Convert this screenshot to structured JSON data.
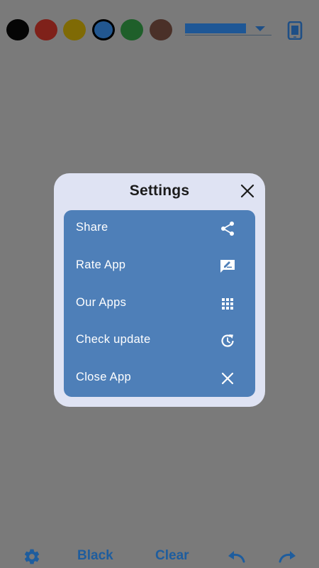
{
  "toolbar": {
    "swatches": [
      {
        "name": "black",
        "color": "#050505"
      },
      {
        "name": "red",
        "color": "#7f211a"
      },
      {
        "name": "yellow",
        "color": "#7f6a05"
      },
      {
        "name": "blue",
        "color": "#225790"
      },
      {
        "name": "green",
        "color": "#1f5f2a"
      },
      {
        "name": "brown",
        "color": "#4a3028"
      }
    ],
    "selected_swatch": "blue",
    "stroke_color": "#1e5796",
    "icon_color": "#1e4f86"
  },
  "dialog": {
    "title": "Settings",
    "close_icon": "close-icon",
    "items": [
      {
        "label": "Share",
        "icon": "share-icon"
      },
      {
        "label": "Rate App",
        "icon": "rate-icon"
      },
      {
        "label": "Our Apps",
        "icon": "apps-grid-icon"
      },
      {
        "label": "Check update",
        "icon": "update-icon"
      },
      {
        "label": "Close App",
        "icon": "close-icon"
      }
    ]
  },
  "bottom_bar": {
    "settings_icon": "gear-icon",
    "color_label": "Black",
    "clear_label": "Clear",
    "undo_icon": "undo-icon",
    "redo_icon": "redo-icon",
    "accent": "#1e5d9e"
  }
}
